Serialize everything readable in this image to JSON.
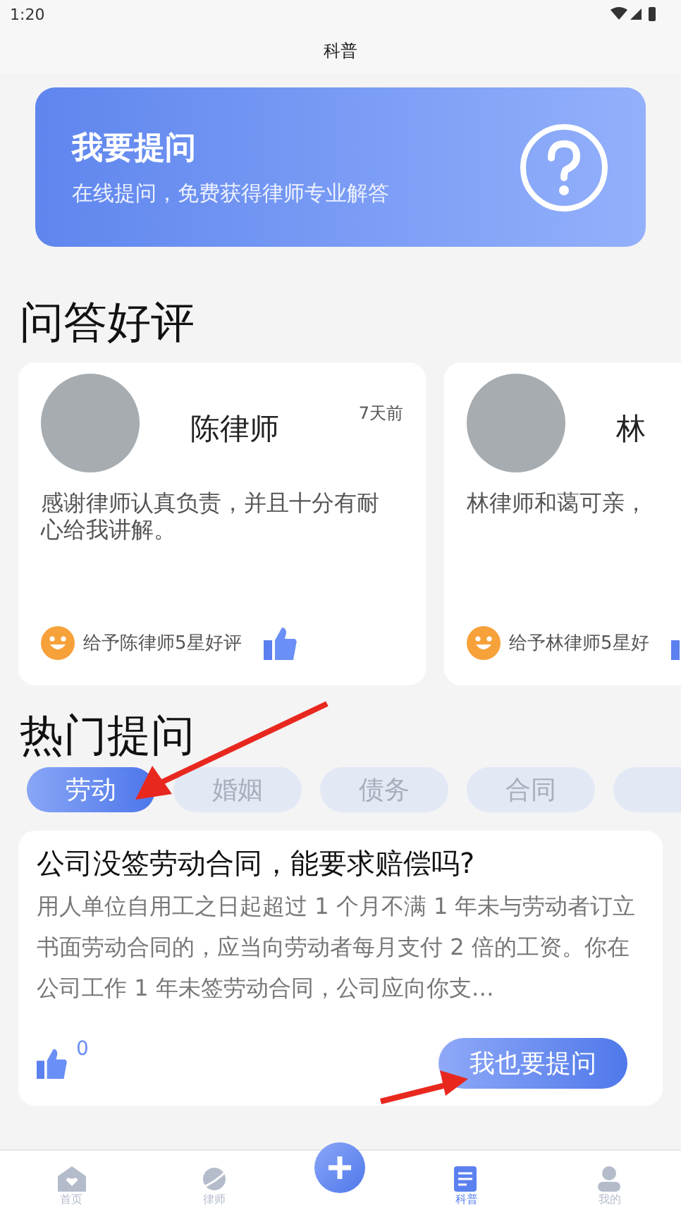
{
  "status_bar": {
    "time": "1:20"
  },
  "header": {
    "title": "科普"
  },
  "banner": {
    "title": "我要提问",
    "subtitle": "在线提问，免费获得律师专业解答"
  },
  "reviews": {
    "heading": "问答好评",
    "cards": [
      {
        "name": "陈律师",
        "time": "7天前",
        "text": "感谢律师认真负责，并且十分有耐心给我讲解。",
        "rating_text": "给予陈律师5星好评"
      },
      {
        "name": "林",
        "text": "林律师和蔼可亲，",
        "rating_text": "给予林律师5星好"
      }
    ]
  },
  "hot": {
    "heading": "热门提问",
    "tabs": [
      {
        "label": "劳动",
        "selected": true
      },
      {
        "label": "婚姻",
        "selected": false
      },
      {
        "label": "债务",
        "selected": false
      },
      {
        "label": "合同",
        "selected": false
      },
      {
        "selected": false
      }
    ],
    "question": {
      "title": "公司没签劳动合同，能要求赔偿吗?",
      "body": "用人单位自用工之日起超过 1 个月不满 1 年未与劳动者订立书面劳动合同的，应当向劳动者每月支付 2 倍的工资。你在公司工作 1 年未签劳动合同，公司应向你支…",
      "likes": "0",
      "button": "我也要提问"
    }
  },
  "tab_bar": [
    {
      "label": "首页",
      "kind": "home",
      "selected": false
    },
    {
      "label": "律师",
      "kind": "lawyer",
      "selected": false
    },
    {
      "label": "科普",
      "kind": "article",
      "selected": true
    },
    {
      "label": "我的",
      "kind": "profile",
      "selected": false
    }
  ]
}
